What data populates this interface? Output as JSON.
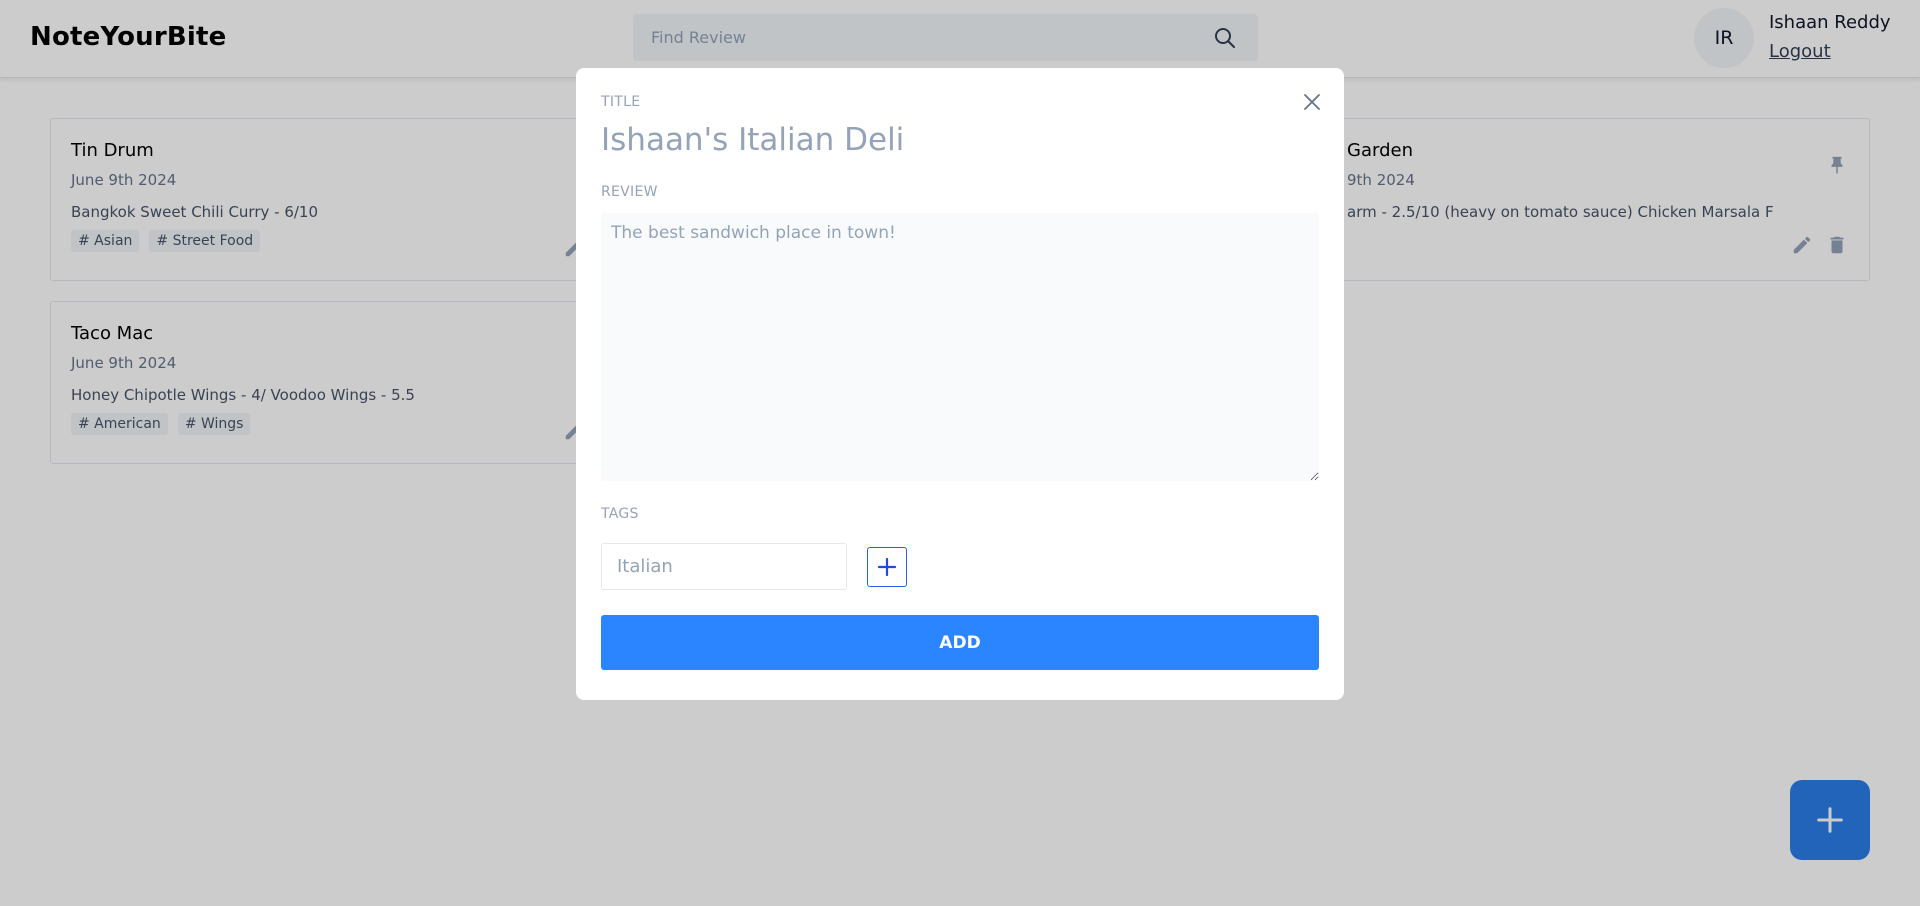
{
  "app": {
    "brand": "NoteYourBite"
  },
  "search": {
    "placeholder": "Find Review",
    "value": ""
  },
  "user": {
    "initials": "IR",
    "name": "Ishaan Reddy",
    "logout_label": "Logout"
  },
  "notes": [
    {
      "title": "Tin Drum",
      "date": "June 9th 2024",
      "content": "Bangkok Sweet Chili Curry - 6/10",
      "tags": [
        "# Asian",
        "# Street Food"
      ]
    },
    {
      "title": "Taco Mac",
      "date": "June 9th 2024",
      "content": "Honey Chipotle Wings - 4/ Voodoo Wings - 5.5",
      "tags": [
        "# American",
        "# Wings"
      ]
    },
    {
      "title": "Garden",
      "date": "9th 2024",
      "content": "arm - 2.5/10 (heavy on tomato sauce) Chicken Marsala F",
      "tags": []
    }
  ],
  "modal": {
    "title_label": "TITLE",
    "title_placeholder": "Ishaan's Italian Deli",
    "title_value": "",
    "review_label": "REVIEW",
    "review_placeholder": "The best sandwich place in town!",
    "review_value": "",
    "tags_label": "TAGS",
    "tag_placeholder": "Italian",
    "tag_value": "",
    "submit_label": "ADD"
  },
  "icons": {
    "search": "search-icon",
    "close": "close-icon",
    "add_tag": "plus-icon",
    "edit": "pencil-icon",
    "delete": "trash-icon",
    "pin": "pin-icon",
    "fab": "plus-icon"
  },
  "colors": {
    "primary": "#2b85ff",
    "fab": "#2b7de9",
    "overlay": "rgba(0,0,0,0.2)"
  }
}
